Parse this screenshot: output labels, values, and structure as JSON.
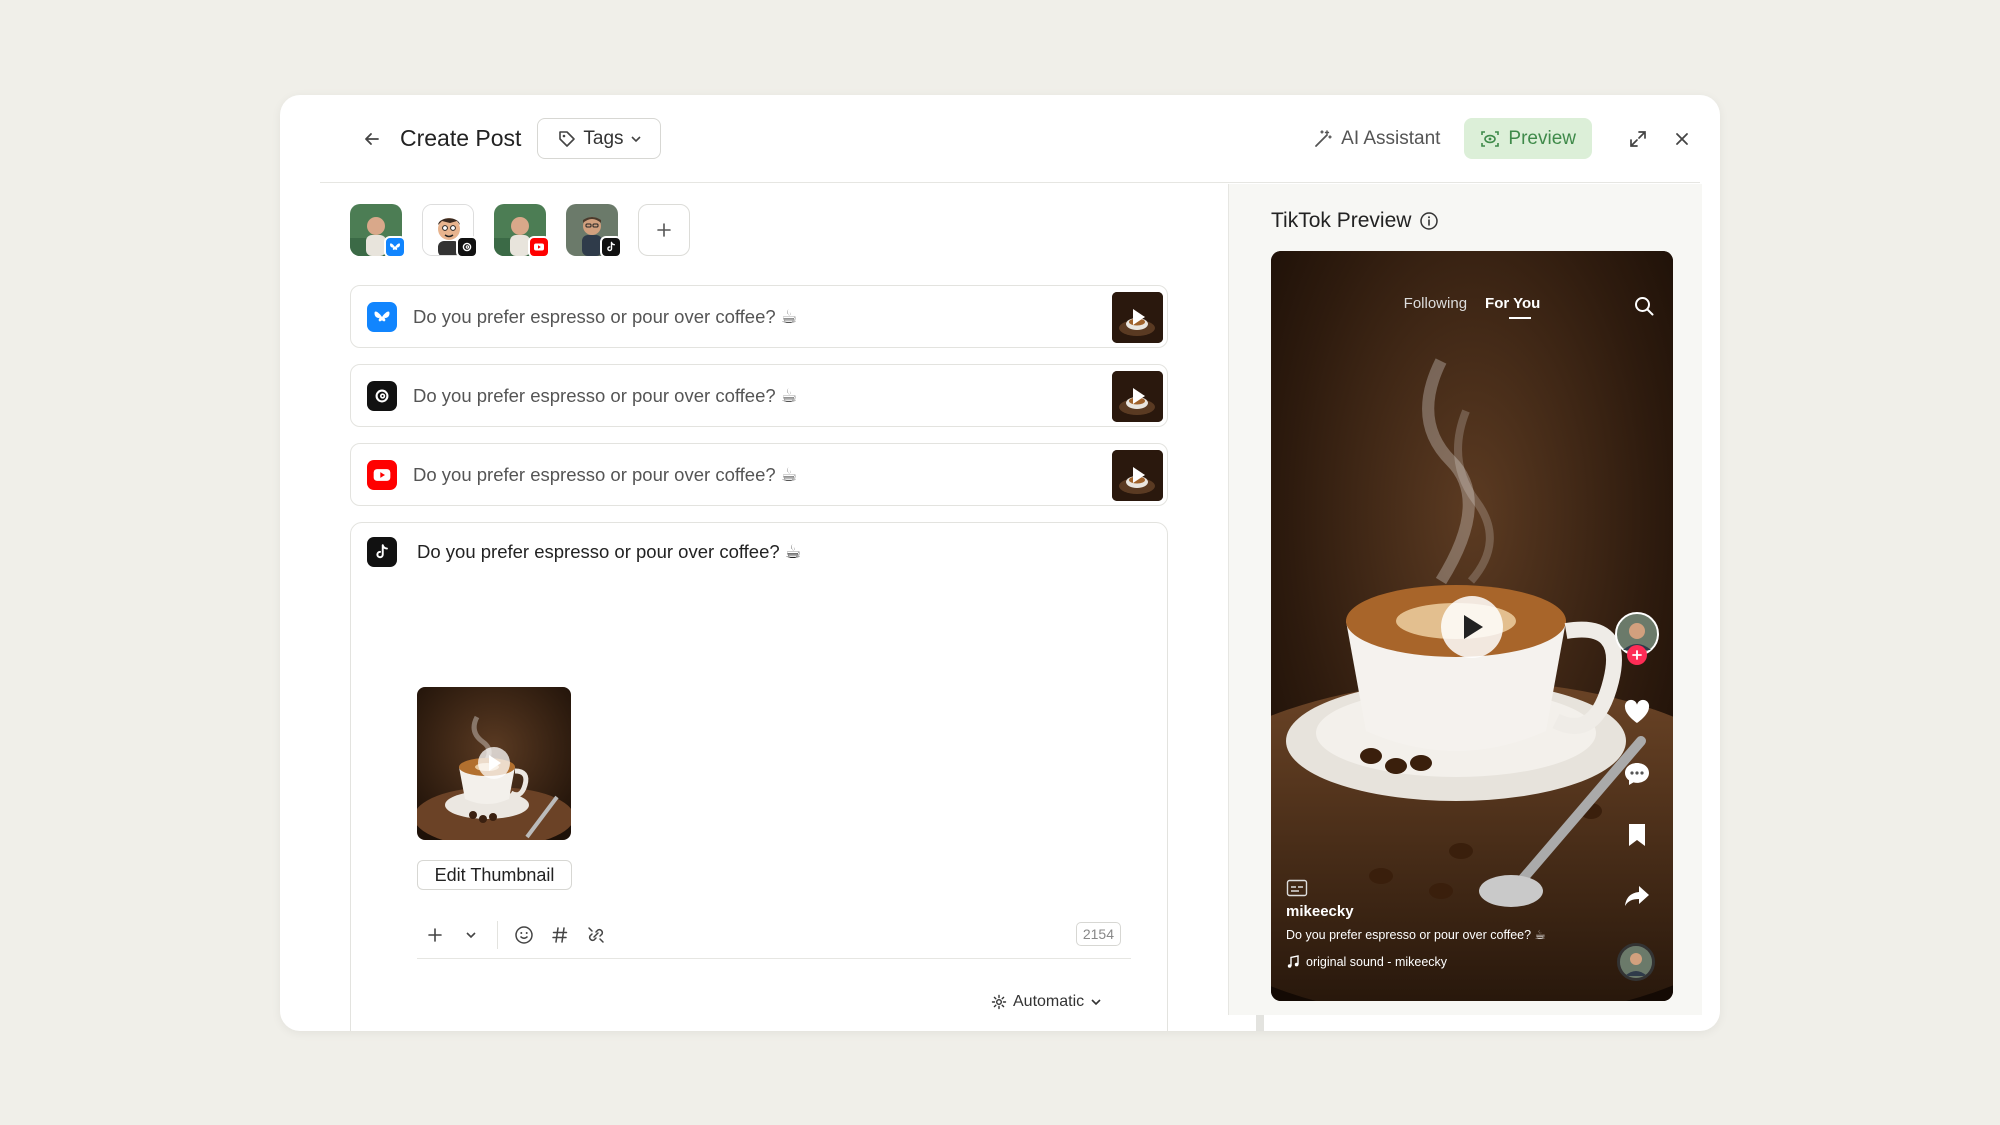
{
  "header": {
    "title": "Create Post",
    "tags_label": "Tags",
    "ai_label": "AI Assistant",
    "preview_label": "Preview"
  },
  "accounts": [
    {
      "network": "bluesky",
      "icon": "butterfly-icon",
      "color": "#1185fe"
    },
    {
      "network": "threads",
      "icon": "threads-icon",
      "color": "#111111"
    },
    {
      "network": "youtube",
      "icon": "youtube-icon",
      "color": "#ff0000"
    },
    {
      "network": "tiktok",
      "icon": "tiktok-icon",
      "color": "#111111"
    }
  ],
  "posts": [
    {
      "network": "bluesky",
      "text": "Do you prefer espresso or pour over coffee? ☕"
    },
    {
      "network": "threads",
      "text": "Do you prefer espresso or pour over coffee? ☕"
    },
    {
      "network": "youtube",
      "text": "Do you prefer espresso or pour over coffee? ☕"
    }
  ],
  "editor": {
    "network": "tiktok",
    "text": "Do you prefer espresso or pour over coffee? ☕",
    "edit_thumbnail_label": "Edit Thumbnail",
    "char_count": "2154",
    "schedule_mode": "Automatic"
  },
  "preview": {
    "title": "TikTok Preview",
    "tab_following": "Following",
    "tab_for_you": "For You",
    "username": "mikeecky",
    "caption": "Do you prefer espresso or pour over coffee? ☕",
    "sound": "original sound - mikeecky"
  },
  "colors": {
    "preview_bg": "#dcefd8",
    "preview_fg": "#3f8a4a",
    "like_red": "#fe2c55"
  }
}
